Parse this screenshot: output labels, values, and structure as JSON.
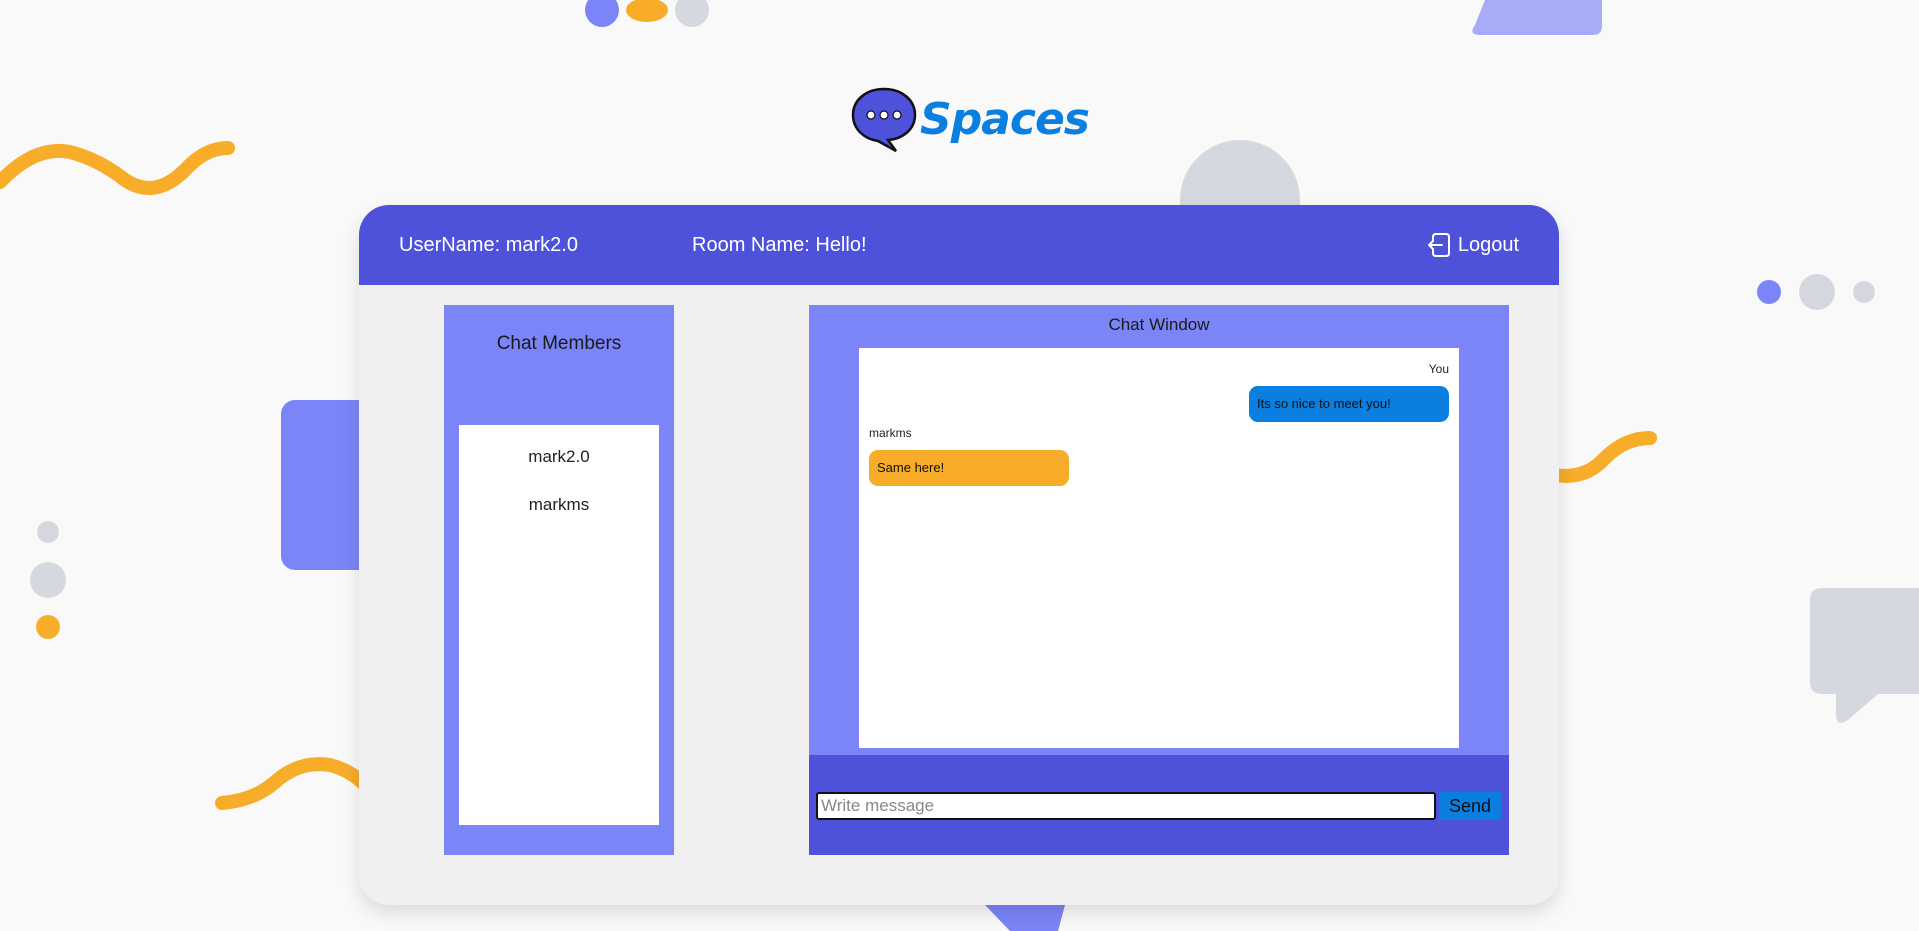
{
  "brand": {
    "name": "Spaces",
    "color": "#0a7fe0"
  },
  "header": {
    "user_label": "UserName: mark2.0",
    "room_label": "Room Name: Hello!",
    "logout_label": "Logout",
    "logout_icon": "logout-icon"
  },
  "members": {
    "title": "Chat Members",
    "items": [
      "mark2.0",
      "markms"
    ]
  },
  "chat": {
    "title": "Chat Window",
    "messages": [
      {
        "sender": "You",
        "text": "Its so nice to meet you!",
        "side": "right",
        "color": "#0a7fe0"
      },
      {
        "sender": "markms",
        "text": "Same here!",
        "side": "left",
        "color": "#f7ac2a"
      }
    ]
  },
  "compose": {
    "placeholder": "Write message",
    "send_label": "Send"
  },
  "colors": {
    "header": "#4e51d9",
    "panel": "#7b85f7",
    "accent_orange": "#f7ac2a",
    "accent_blue": "#0a7fe0"
  }
}
